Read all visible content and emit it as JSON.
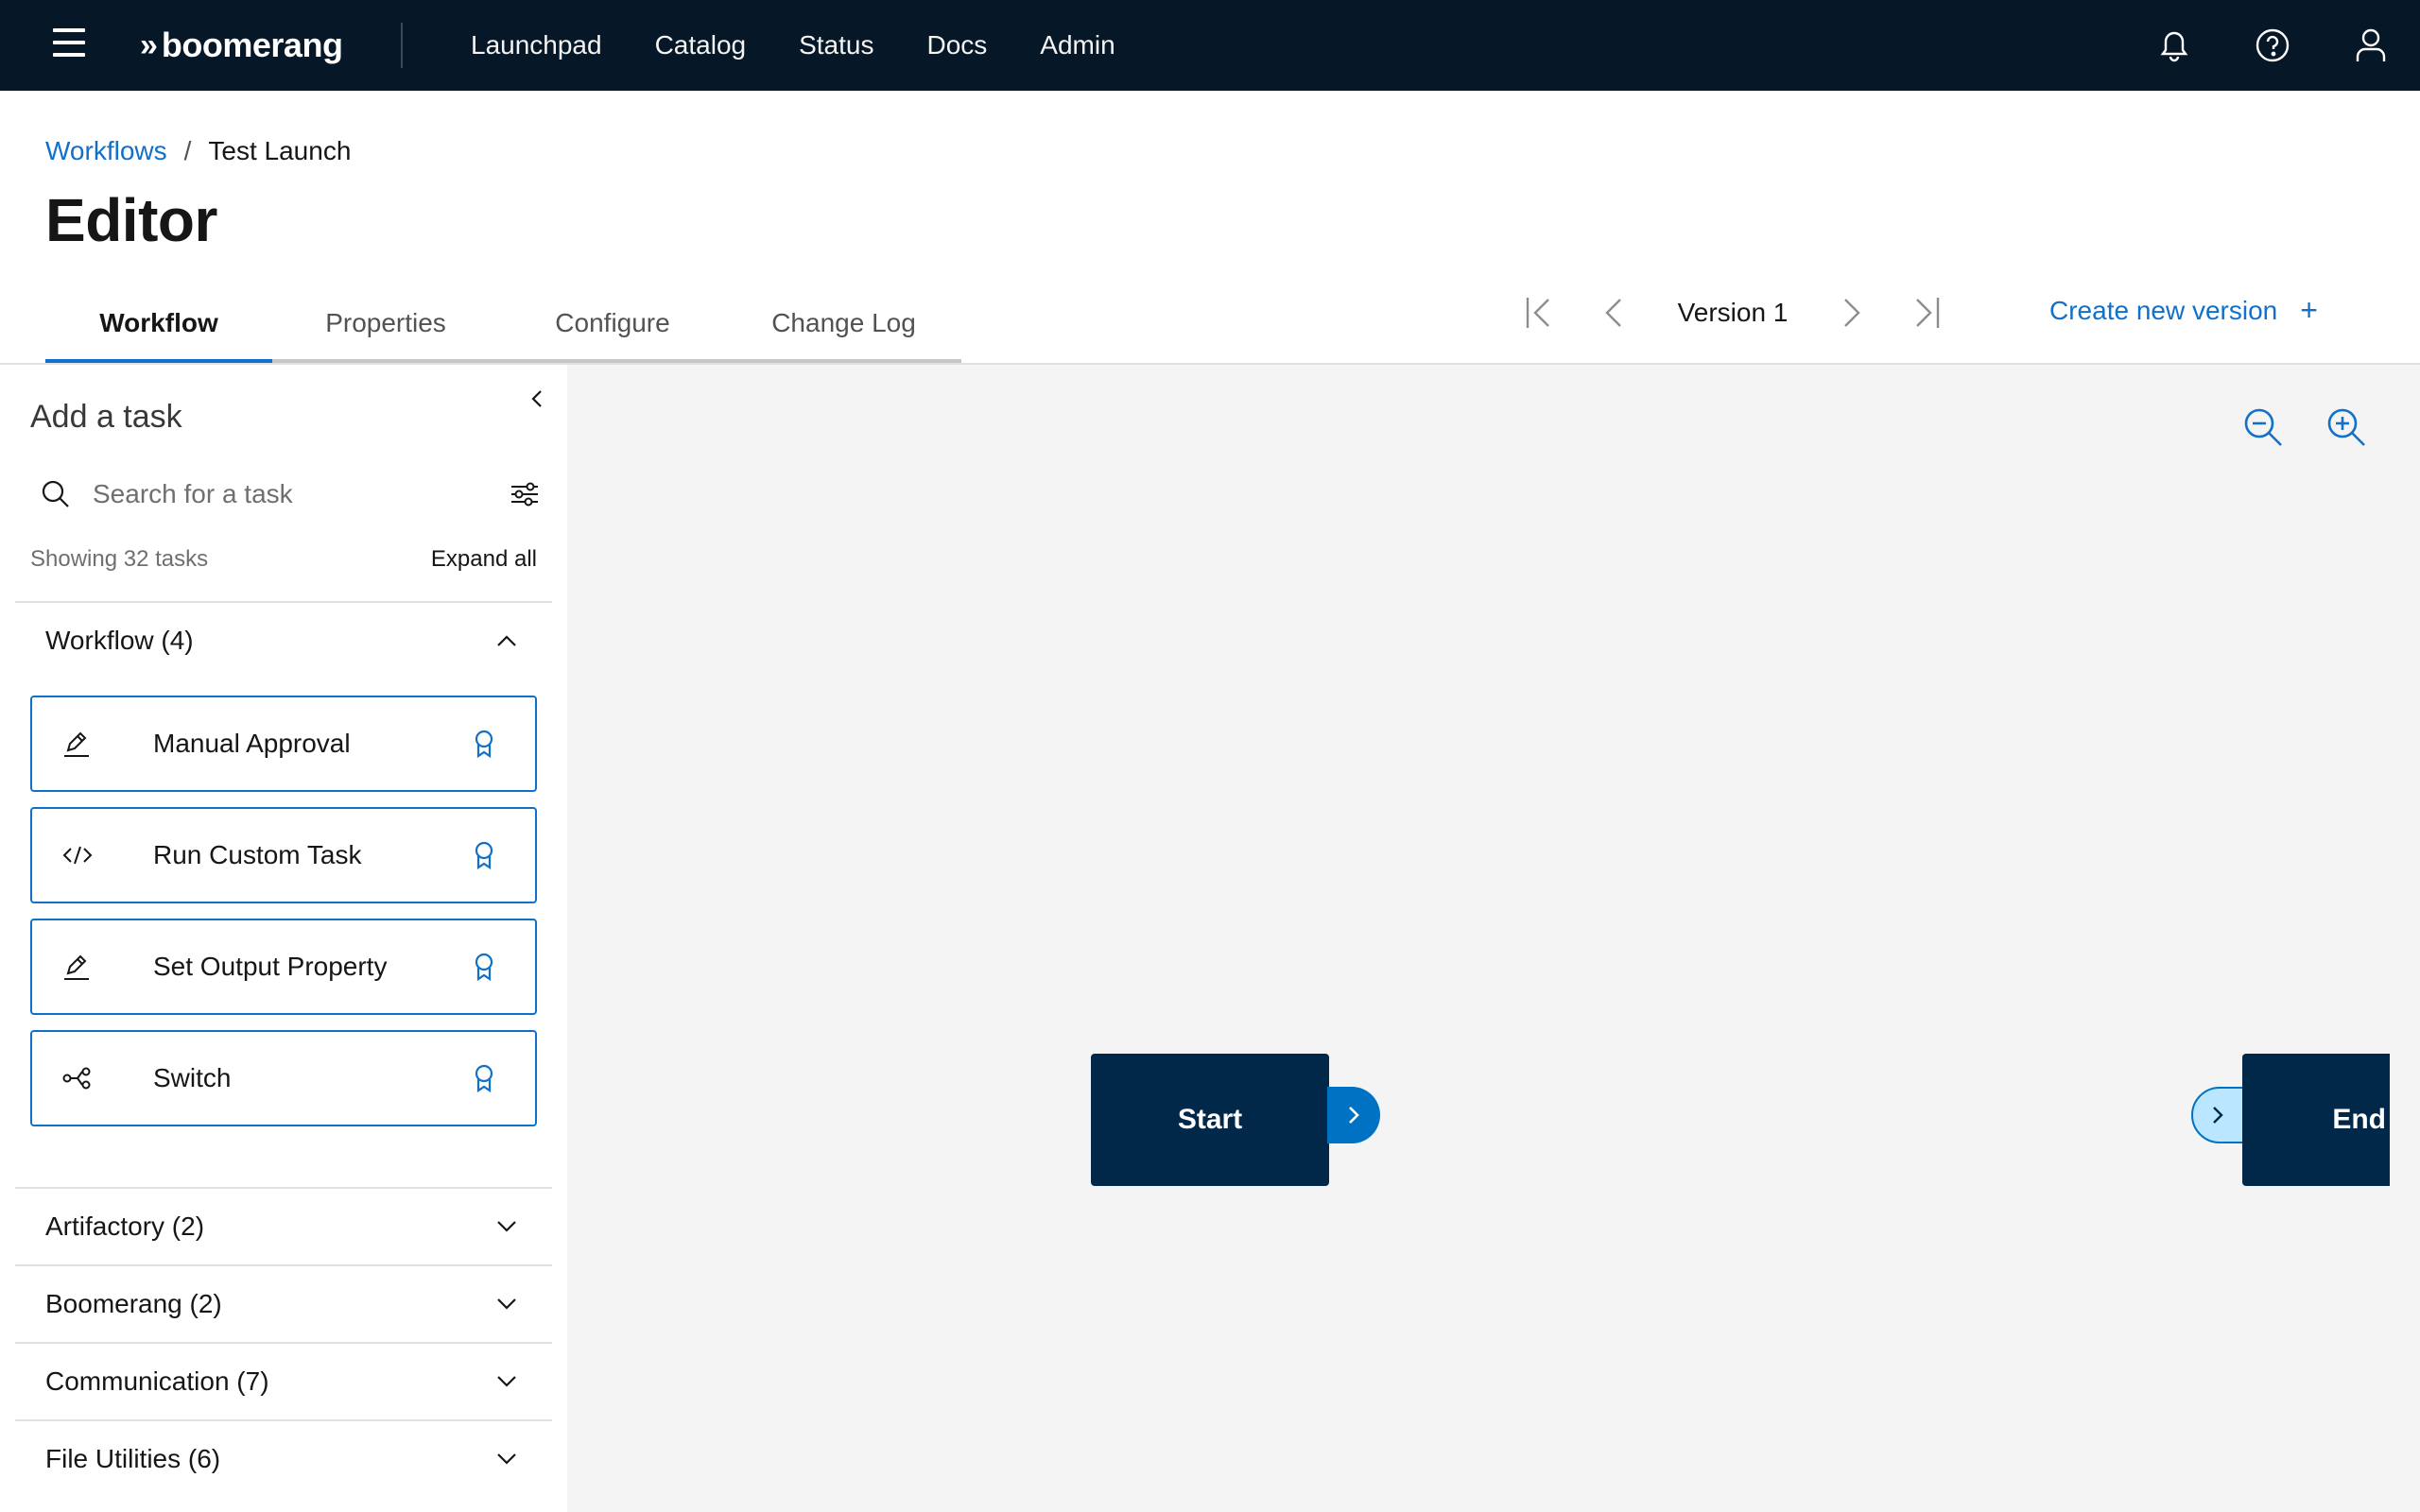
{
  "topbar": {
    "brand_mark": "»",
    "brand_name": "boomerang",
    "nav": [
      "Launchpad",
      "Catalog",
      "Status",
      "Docs",
      "Admin"
    ],
    "icons": [
      "bell-icon",
      "help-icon",
      "user-icon"
    ]
  },
  "breadcrumb": {
    "parent": "Workflows",
    "separator": "/",
    "current": "Test Launch"
  },
  "page": {
    "title": "Editor"
  },
  "tabs": [
    "Workflow",
    "Properties",
    "Configure",
    "Change Log"
  ],
  "active_tab": "Workflow",
  "version": {
    "label": "Version 1",
    "create_label": "Create new version",
    "create_icon": "+"
  },
  "sidebar": {
    "title": "Add a task",
    "search_placeholder": "Search for a task",
    "showing": "Showing 32 tasks",
    "expand_all": "Expand all",
    "sections": [
      {
        "title": "Workflow (4)",
        "expanded": true,
        "tasks": [
          {
            "name": "Manual Approval",
            "icon": "edit-icon"
          },
          {
            "name": "Run Custom Task",
            "icon": "code-icon"
          },
          {
            "name": "Set Output Property",
            "icon": "edit-icon"
          },
          {
            "name": "Switch",
            "icon": "switch-icon"
          }
        ]
      },
      {
        "title": "Artifactory (2)",
        "expanded": false
      },
      {
        "title": "Boomerang (2)",
        "expanded": false
      },
      {
        "title": "Communication (7)",
        "expanded": false
      },
      {
        "title": "File Utilities (6)",
        "expanded": false
      }
    ]
  },
  "canvas": {
    "start_label": "Start",
    "end_label": "End"
  },
  "colors": {
    "topbar_bg": "#061727",
    "accent": "#1070ca",
    "node_bg": "#012749",
    "port_out": "#0072c3",
    "port_in": "#bae6ff",
    "canvas_bg": "#f4f4f4"
  }
}
